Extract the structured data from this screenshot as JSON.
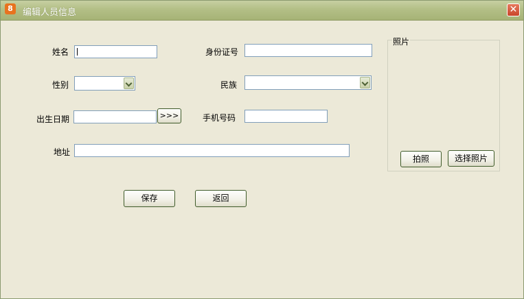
{
  "window": {
    "title": "编辑人员信息",
    "app_icon_glyph": "8",
    "close_glyph": "✕"
  },
  "form": {
    "name_label": "姓名",
    "name_value": "",
    "id_label": "身份证号",
    "id_value": "",
    "gender_label": "性别",
    "gender_selected": "",
    "ethnicity_label": "民族",
    "ethnicity_selected": "",
    "birth_label": "出生日期",
    "birth_value": "",
    "date_picker_label": ">>>",
    "phone_label": "手机号码",
    "phone_value": "",
    "address_label": "地址",
    "address_value": ""
  },
  "photo": {
    "group_label": "照片",
    "capture_button": "拍照",
    "choose_button": "选择照片"
  },
  "actions": {
    "save_label": "保存",
    "back_label": "返回"
  },
  "colors": {
    "titlebar": "#b3bf86",
    "window_bg": "#ece9d8",
    "close_button": "#d2573a",
    "button_border": "#3f5b2a"
  }
}
